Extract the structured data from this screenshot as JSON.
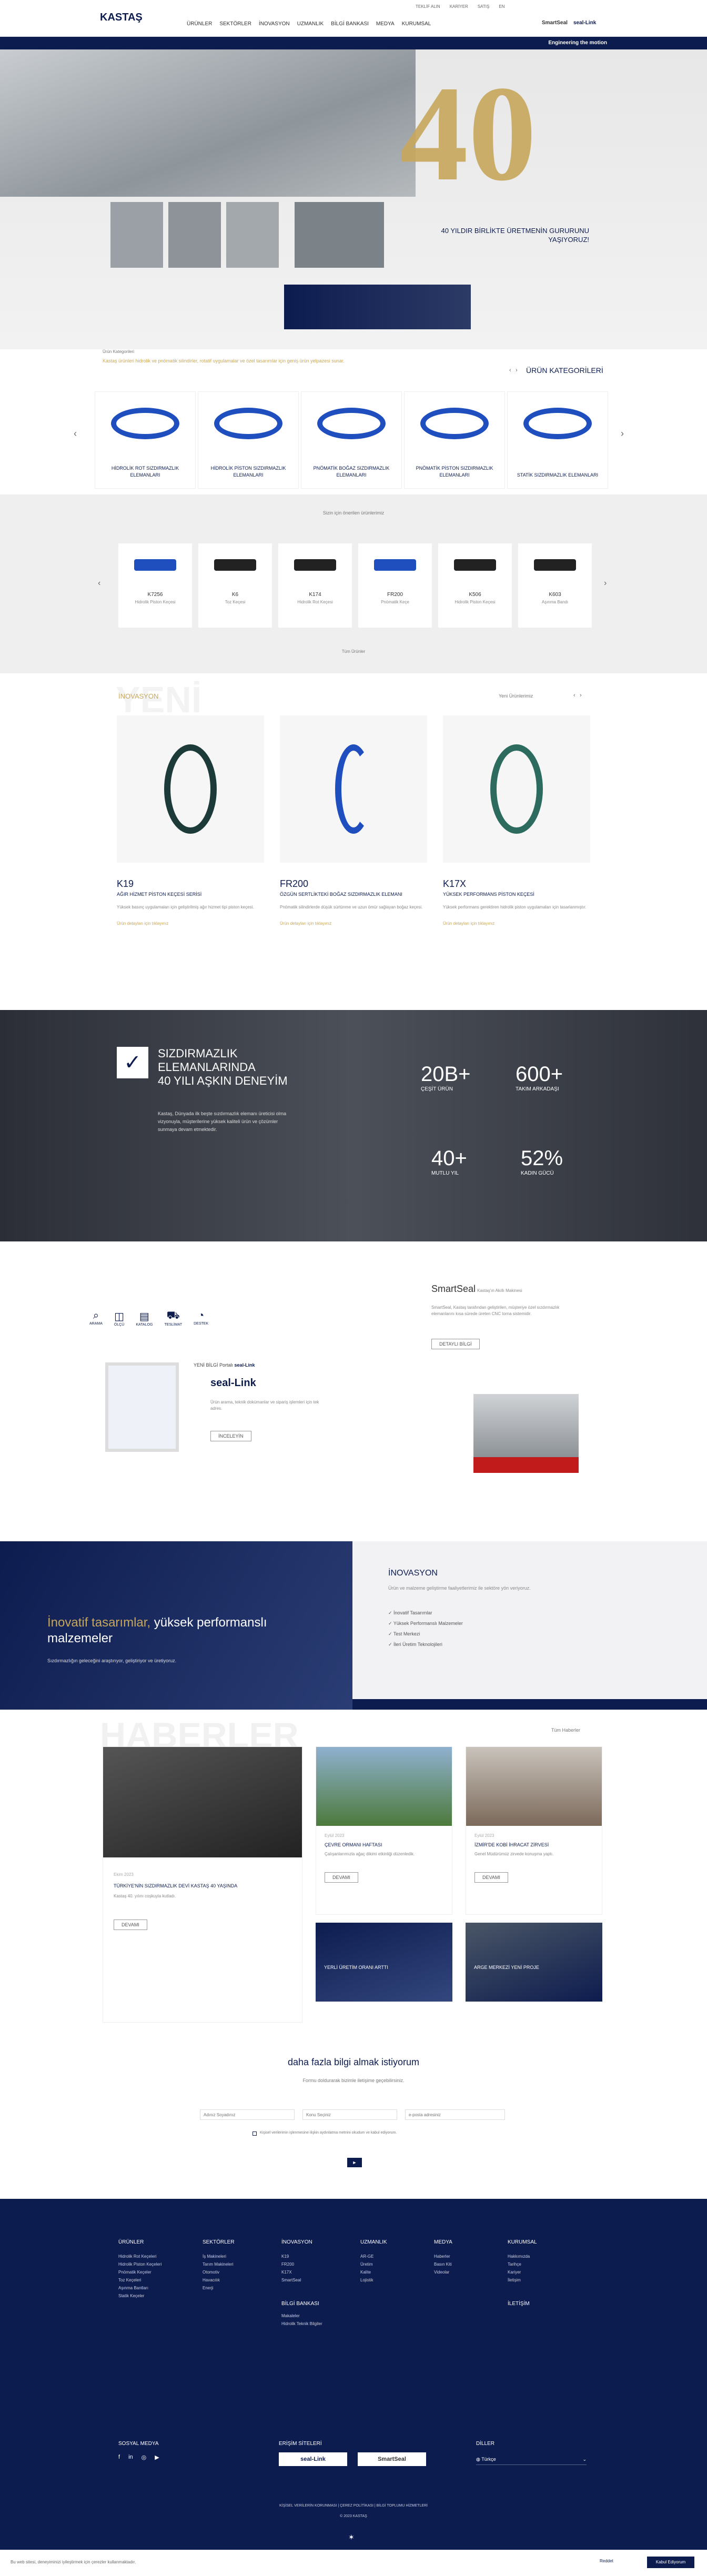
{
  "header": {
    "brand": "KASTAŞ",
    "nav": [
      "ÜRÜNLER",
      "SEKTÖRLER",
      "İNOVASYON",
      "UZMANLIK",
      "BİLGİ BANKASI",
      "MEDYA",
      "KURUMSAL"
    ],
    "top_links": [
      "TEKLİF ALIN",
      "KARİYER",
      "SATIŞ",
      "EN"
    ],
    "smart": "SmartSeal",
    "seal": "seal-Link",
    "engineering": "Engineering the motion"
  },
  "hero": {
    "caption_l1": "40 YILDIR BİRLİKTE ÜRETMENİN GURURUNU",
    "caption_l2": "YAŞIYORUZ!"
  },
  "categories": {
    "label": "Ürün Kategorileri",
    "title": "ÜRÜN KATEGORİLERİ",
    "desc": "Kastaş ürünleri hidrolik ve pnömatik silindirler, rotatif uygulamalar ve özel tasarımlar için geniş ürün yelpazesi sunar.",
    "items": [
      "HİDROLİK ROT SIZDIRMAZLIK ELEMANLARI",
      "HİDROLİK PİSTON SIZDIRMAZLIK ELEMANLARI",
      "PNÖMATİK BOĞAZ SIZDIRMAZLIK ELEMANLARI",
      "PNÖMATİK PİSTON SIZDIRMAZLIK ELEMANLARI",
      "STATİK SIZDIRMAZLIK ELEMANLARI"
    ]
  },
  "products": {
    "note": "Sizin için önerilen ürünlerimiz",
    "items": [
      {
        "code": "K7256",
        "desc": "Hidrolik Piston Keçesi"
      },
      {
        "code": "K6",
        "desc": "Toz Keçesi"
      },
      {
        "code": "K174",
        "desc": "Hidrolik Rot Keçesi"
      },
      {
        "code": "FR200",
        "desc": "Pnömatik Keçe"
      },
      {
        "code": "K506",
        "desc": "Hidrolik Piston Keçesi"
      },
      {
        "code": "K603",
        "desc": "Aşınma Bandı"
      }
    ],
    "more": "Tüm Ürünler"
  },
  "innovation": {
    "bg_word": "YENİ",
    "label": "İNOVASYON",
    "link": "Yeni Ürünlerimiz",
    "items": [
      {
        "code": "K19",
        "sub": "AĞIR HİZMET PİSTON KEÇESİ SERİSİ",
        "text": "Yüksek basınç uygulamaları için geliştirilmiş ağır hizmet tipi piston keçesi.",
        "link": "Ürün detayları için tıklayınız"
      },
      {
        "code": "FR200",
        "sub": "ÖZGÜN SERTLİKTEKİ BOĞAZ SIZDIRMAZLIK ELEMANI",
        "text": "Pnömatik silindirlerde düşük sürtünme ve uzun ömür sağlayan boğaz keçesi.",
        "link": "Ürün detayları için tıklayınız"
      },
      {
        "code": "K17X",
        "sub": "YÜKSEK PERFORMANS PİSTON KEÇESİ",
        "text": "Yüksek performans gerektiren hidrolik piston uygulamaları için tasarlanmıştır.",
        "link": "Ürün detayları için tıklayınız"
      }
    ]
  },
  "experience": {
    "l1": "SIZDIRMAZLIK",
    "l2": "ELEMANLARINDA",
    "l3": "40 YILI AŞKIN DENEYİM",
    "text": "Kastaş, Dünyada ilk beşte sızdırmazlık elemanı üreticisi olma vizyonuyla, müşterilerine yüksek kaliteli ürün ve çözümler sunmaya devam etmektedir.",
    "stats": [
      {
        "v": "20B+",
        "l": "ÇEŞİT ÜRÜN"
      },
      {
        "v": "600+",
        "l": "TAKIM ARKADAŞI"
      },
      {
        "v": "40+",
        "l": "MUTLU YIL"
      },
      {
        "v": "52%",
        "l": "KADIN GÜCÜ"
      }
    ]
  },
  "tools": {
    "icons": [
      "ARAMA",
      "ÖLÇÜ",
      "KATALOG",
      "TESLİMAT",
      "DESTEK"
    ],
    "seal_pre": "YENİ BİLGİ Portalı",
    "seal_post": "seal-Link",
    "seal_text": "Ürün arama, teknik dokümanlar ve sipariş işlemleri için tek adres.",
    "seal_btn": "İNCELEYİN",
    "smart_title": "SmartSeal",
    "smart_sub": "Kastaş'ın Akıllı Makinesi",
    "smart_text": "SmartSeal, Kastaş tarafından geliştirilen, müşteriye özel sızdırmazlık elemanlarını kısa sürede üreten CNC torna sistemidir.",
    "smart_btn": "DETAYLI BİLGİ"
  },
  "innov_band": {
    "title1": "İnovatif tasarımlar, ",
    "title2": "yüksek performanslı",
    "title3": "malzemeler",
    "text": "Sızdırmazlığın geleceğini araştırıyor, geliştiriyor ve üretiyoruz.",
    "r_title": "İNOVASYON",
    "r_text": "Ürün ve malzeme geliştirme faaliyetlerimiz ile sektöre yön veriyoruz.",
    "list": [
      "İnovatif Tasarımlar",
      "Yüksek Performanslı Malzemeler",
      "Test Merkezi",
      "İleri Üretim Teknolojileri"
    ]
  },
  "news": {
    "bg": "HABERLER",
    "link": "Tüm Haberler",
    "items": [
      {
        "date": "Ekim 2023",
        "title": "TÜRKİYE'NİN SIZDIRMAZLIK DEVİ KASTAŞ 40 YAŞINDA",
        "text": "Kastaş 40. yılını coşkuyla kutladı."
      },
      {
        "date": "Eylül 2023",
        "title": "ÇEVRE ORMANI HAFTASI",
        "text": "Çalışanlarımızla ağaç dikimi etkinliği düzenledik."
      },
      {
        "date": "Eylül 2023",
        "title": "İZMİR'DE KOBİ İHRACAT ZİRVESİ",
        "text": "Genel Müdürümüz zirvede konuşma yaptı."
      },
      {
        "date": "Ağustos 2023",
        "title": "YERLİ ÜRETİM ORANI ARTTI",
        "text": ""
      },
      {
        "date": "Temmuz 2023",
        "title": "ARGE MERKEZİ YENİ PROJE",
        "text": ""
      }
    ],
    "btn": "DEVAMI"
  },
  "form": {
    "title": "daha fazla bilgi almak istiyorum",
    "l1": "Formu doldurarak bizimle iletişime geçebilirsiniz.",
    "ph_name": "Adınız Soyadınız",
    "ph_topic": "Konu Seçiniz",
    "ph_mail": "e-posta adresiniz",
    "consent": "Kişisel verilerimin işlenmesine ilişkin aydınlatma metnini okudum ve kabul ediyorum.",
    "submit": "►"
  },
  "footer": {
    "cols": [
      {
        "h": "ÜRÜNLER",
        "items": [
          "Hidrolik Rot Keçeleri",
          "Hidrolik Piston Keçeleri",
          "Pnömatik Keçeler",
          "Toz Keçeleri",
          "Aşınma Bantları",
          "Statik Keçeler"
        ]
      },
      {
        "h": "SEKTÖRLER",
        "items": [
          "İş Makineleri",
          "Tarım Makineleri",
          "Otomotiv",
          "Havacılık",
          "Enerji"
        ]
      },
      {
        "h": "İNOVASYON",
        "items": [
          "K19",
          "FR200",
          "K17X",
          "SmartSeal"
        ]
      },
      {
        "h": "UZMANLIK",
        "items": [
          "AR-GE",
          "Üretim",
          "Kalite",
          "Lojistik"
        ]
      },
      {
        "h": "MEDYA",
        "items": [
          "Haberler",
          "Basın Kiti",
          "Videolar"
        ]
      },
      {
        "h": "KURUMSAL",
        "items": [
          "Hakkımızda",
          "Tarihçe",
          "Kariyer",
          "İletişim"
        ]
      }
    ],
    "bilgi": "BİLGİ BANKASI",
    "bilgi_items": [
      "Makaleler",
      "Hidrolik Teknik Bilgiler"
    ],
    "iletisim": "İLETİŞİM",
    "social": "SOSYAL MEDYA",
    "sites": "ERİŞİM SİTELERİ",
    "lang": "DİLLER",
    "lang_val": "Türkçe",
    "bottom_links": "KİŞİSEL VERİLERİN KORUNMASI | ÇEREZ POLİTİKASI | BİLGİ TOPLUMU HİZMETLERİ",
    "copy": "© 2023 KASTAŞ"
  },
  "cookie": {
    "text": "Bu web sitesi, deneyiminizi iyileştirmek için çerezler kullanmaktadır.",
    "btn1": "Reddet",
    "btn2": "Kabul Ediyorum"
  }
}
